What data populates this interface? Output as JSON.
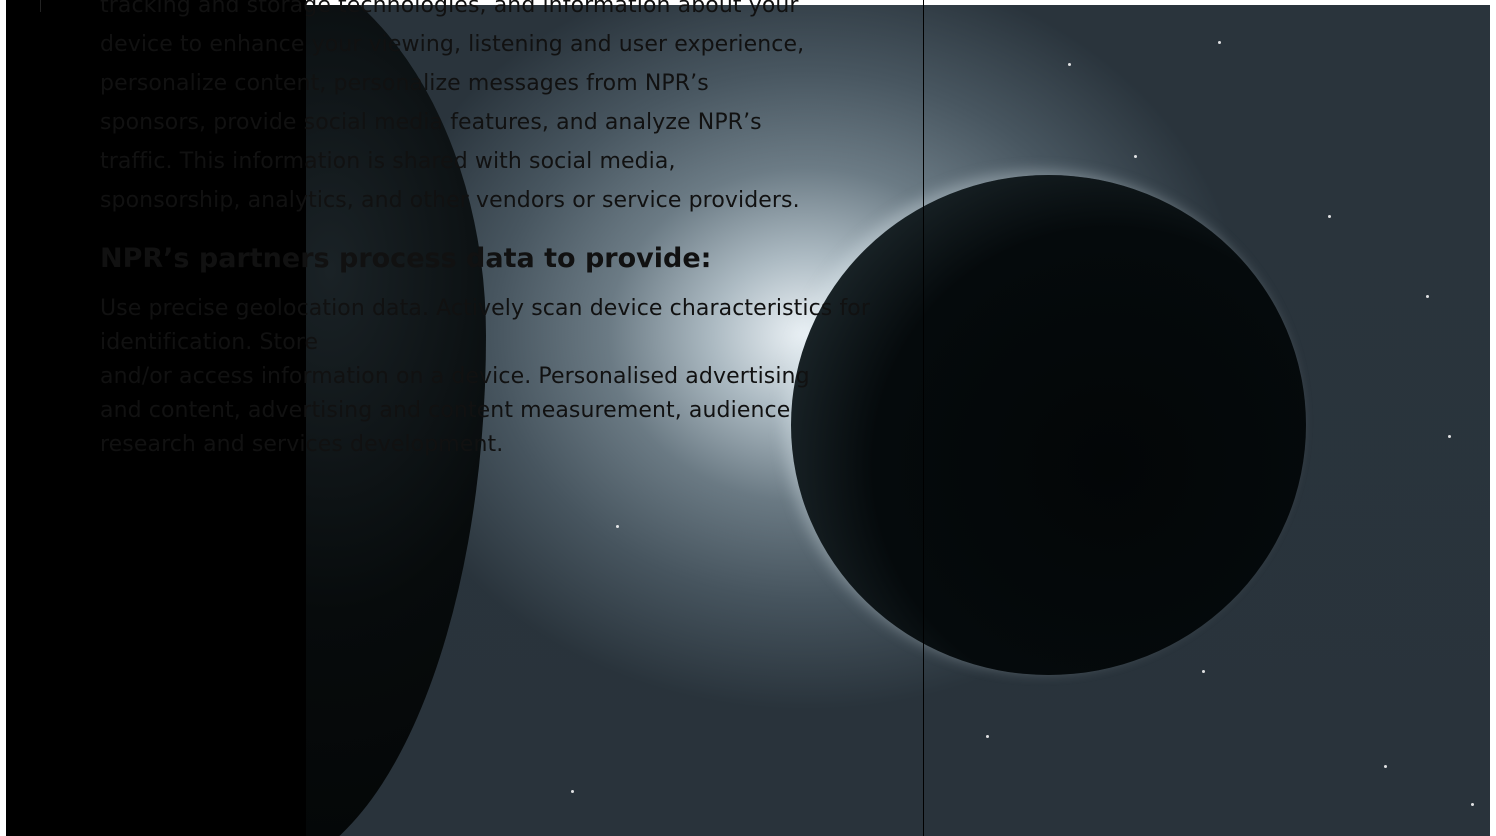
{
  "consent": {
    "intro_lines": [
      "tracking and storage technologies, and information about your",
      "device to enhance your viewing, listening and user experience,",
      "personalize content, personalize messages from NPR’s",
      "sponsors, provide social media features, and analyze NPR’s",
      "traffic. This information is shared with social media,",
      "sponsorship, analytics, and other vendors or service providers."
    ],
    "partners_heading": "NPR’s partners process data to provide:",
    "purposes_lines": [
      "Use precise geolocation data. Actively scan device characteristics for identification. Store",
      "and/or access information on a device. Personalised advertising",
      "and content, advertising and content measurement, audience",
      "research and services development."
    ]
  },
  "hero": {
    "alt_description": "",
    "colors": {
      "glow": "#f0f6fa",
      "space": "#39464f",
      "moon_shadow": "#030607"
    }
  }
}
